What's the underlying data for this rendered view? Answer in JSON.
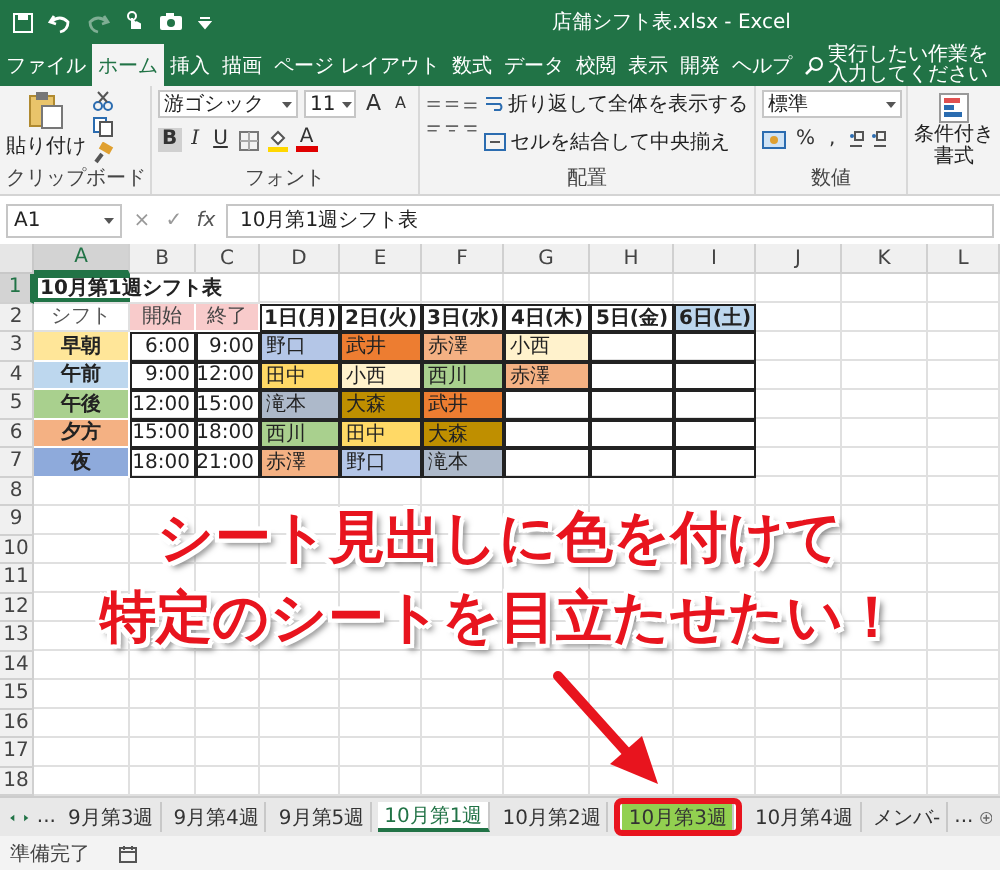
{
  "window": {
    "title": "店舗シフト表.xlsx - Excel"
  },
  "ribbon_tabs": [
    {
      "label": "ファイル",
      "selected": false
    },
    {
      "label": "ホーム",
      "selected": true
    },
    {
      "label": "挿入",
      "selected": false
    },
    {
      "label": "描画",
      "selected": false
    },
    {
      "label": "ページ レイアウト",
      "selected": false
    },
    {
      "label": "数式",
      "selected": false
    },
    {
      "label": "データ",
      "selected": false
    },
    {
      "label": "校閲",
      "selected": false
    },
    {
      "label": "表示",
      "selected": false
    },
    {
      "label": "開発",
      "selected": false
    },
    {
      "label": "ヘルプ",
      "selected": false
    }
  ],
  "search": {
    "placeholder": "実行したい作業を入力してください"
  },
  "ribbon": {
    "clipboard": {
      "paste": "貼り付け",
      "label": "クリップボード"
    },
    "font": {
      "name": "游ゴシック",
      "size": "11",
      "grow": "A",
      "shrink": "A",
      "bold": "B",
      "italic": "I",
      "underline": "U",
      "font_color": "A",
      "label": "フォント"
    },
    "alignment": {
      "wrap": "折り返して全体を表示する",
      "merge": "セルを結合して中央揃え",
      "label": "配置"
    },
    "number": {
      "format": "標準",
      "percent": "%",
      "comma": ",",
      "label": "数値"
    },
    "styles": {
      "conditional": "条件付き書式"
    }
  },
  "formula_bar": {
    "name_box": "A1",
    "cancel": "×",
    "enter": "✓",
    "function_label": "fx",
    "formula": "10月第1週シフト表"
  },
  "sheet": {
    "columns": [
      {
        "label": "A",
        "selected": true
      },
      {
        "label": "B",
        "selected": false
      },
      {
        "label": "C",
        "selected": false
      },
      {
        "label": "D",
        "selected": false
      },
      {
        "label": "E",
        "selected": false
      },
      {
        "label": "F",
        "selected": false
      },
      {
        "label": "G",
        "selected": false
      },
      {
        "label": "H",
        "selected": false
      },
      {
        "label": "I",
        "selected": false
      },
      {
        "label": "J",
        "selected": false
      },
      {
        "label": "K",
        "selected": false
      },
      {
        "label": "L",
        "selected": false
      }
    ],
    "rows": [
      {
        "number": "1",
        "selected": true,
        "cells": [
          {
            "kind": "title",
            "text": "10月第1週シフト表"
          }
        ]
      },
      {
        "number": "2",
        "selected": false,
        "cells": [
          {
            "kind": "label",
            "text": "シフト"
          },
          {
            "kind": "head",
            "text": "開始",
            "color": "#f8cbcb"
          },
          {
            "kind": "head",
            "text": "終了",
            "color": "#f8cbcb"
          },
          {
            "kind": "day",
            "text": "1日(月)"
          },
          {
            "kind": "day",
            "text": "2日(火)"
          },
          {
            "kind": "day",
            "text": "3日(水)"
          },
          {
            "kind": "day",
            "text": "4日(木)"
          },
          {
            "kind": "day",
            "text": "5日(金)"
          },
          {
            "kind": "day",
            "text": "6日(土)",
            "color": "#bdd7ee"
          }
        ]
      },
      {
        "number": "3",
        "selected": false,
        "cells": [
          {
            "kind": "shift",
            "text": "早朝",
            "color": "#ffe699"
          },
          {
            "kind": "time",
            "text": "6:00"
          },
          {
            "kind": "time",
            "text": "9:00"
          },
          {
            "kind": "name",
            "text": "野口",
            "color": "#b4c6e7"
          },
          {
            "kind": "name",
            "text": "武井",
            "color": "#ed7d31"
          },
          {
            "kind": "name",
            "text": "赤澤",
            "color": "#f4b183"
          },
          {
            "kind": "name",
            "text": "小西",
            "color": "#fff2cc"
          },
          {
            "kind": "blank"
          },
          {
            "kind": "blank"
          }
        ]
      },
      {
        "number": "4",
        "selected": false,
        "cells": [
          {
            "kind": "shift",
            "text": "午前",
            "color": "#bdd7ee"
          },
          {
            "kind": "time",
            "text": "9:00"
          },
          {
            "kind": "time",
            "text": "12:00"
          },
          {
            "kind": "name",
            "text": "田中",
            "color": "#ffd966"
          },
          {
            "kind": "name",
            "text": "小西",
            "color": "#fff2cc"
          },
          {
            "kind": "name",
            "text": "西川",
            "color": "#a9d08e"
          },
          {
            "kind": "name",
            "text": "赤澤",
            "color": "#f4b183"
          },
          {
            "kind": "blank"
          },
          {
            "kind": "blank"
          }
        ]
      },
      {
        "number": "5",
        "selected": false,
        "cells": [
          {
            "kind": "shift",
            "text": "午後",
            "color": "#a9d08e"
          },
          {
            "kind": "time",
            "text": "12:00"
          },
          {
            "kind": "time",
            "text": "15:00"
          },
          {
            "kind": "name",
            "text": "滝本",
            "color": "#adb9ca"
          },
          {
            "kind": "name",
            "text": "大森",
            "color": "#bf8f00"
          },
          {
            "kind": "name",
            "text": "武井",
            "color": "#ed7d31"
          },
          {
            "kind": "blank"
          },
          {
            "kind": "blank"
          },
          {
            "kind": "blank"
          }
        ]
      },
      {
        "number": "6",
        "selected": false,
        "cells": [
          {
            "kind": "shift",
            "text": "夕方",
            "color": "#f4b183"
          },
          {
            "kind": "time",
            "text": "15:00"
          },
          {
            "kind": "time",
            "text": "18:00"
          },
          {
            "kind": "name",
            "text": "西川",
            "color": "#a9d08e"
          },
          {
            "kind": "name",
            "text": "田中",
            "color": "#ffd966"
          },
          {
            "kind": "name",
            "text": "大森",
            "color": "#bf8f00"
          },
          {
            "kind": "blank"
          },
          {
            "kind": "blank"
          },
          {
            "kind": "blank"
          }
        ]
      },
      {
        "number": "7",
        "selected": false,
        "cells": [
          {
            "kind": "shift",
            "text": "夜",
            "color": "#8eaadb"
          },
          {
            "kind": "time",
            "text": "18:00"
          },
          {
            "kind": "time",
            "text": "21:00"
          },
          {
            "kind": "name",
            "text": "赤澤",
            "color": "#f4b183"
          },
          {
            "kind": "name",
            "text": "野口",
            "color": "#b4c6e7"
          },
          {
            "kind": "name",
            "text": "滝本",
            "color": "#adb9ca"
          },
          {
            "kind": "blank"
          },
          {
            "kind": "blank"
          },
          {
            "kind": "blank"
          }
        ]
      },
      {
        "number": "8",
        "selected": false
      },
      {
        "number": "9",
        "selected": false
      },
      {
        "number": "10",
        "selected": false
      },
      {
        "number": "11",
        "selected": false
      },
      {
        "number": "12",
        "selected": false
      },
      {
        "number": "13",
        "selected": false
      },
      {
        "number": "14",
        "selected": false
      },
      {
        "number": "15",
        "selected": false
      },
      {
        "number": "16",
        "selected": false
      },
      {
        "number": "17",
        "selected": false
      },
      {
        "number": "18",
        "selected": false
      }
    ]
  },
  "sheet_tabs": {
    "more_left": "...",
    "tabs": [
      {
        "label": "9月第3週",
        "selected": false,
        "highlighted": false
      },
      {
        "label": "9月第4週",
        "selected": false,
        "highlighted": false
      },
      {
        "label": "9月第5週",
        "selected": false,
        "highlighted": false
      },
      {
        "label": "10月第1週",
        "selected": true,
        "highlighted": false
      },
      {
        "label": "10月第2週",
        "selected": false,
        "highlighted": false
      },
      {
        "label": "10月第3週",
        "selected": false,
        "highlighted": true,
        "color": "#92d050"
      },
      {
        "label": "10月第4週",
        "selected": false,
        "highlighted": false
      },
      {
        "label": "メンバ-",
        "selected": false,
        "highlighted": false
      }
    ],
    "more_right": "..."
  },
  "status_bar": {
    "text": "準備完了"
  },
  "annotation": {
    "lines": [
      "シート見出しに色を付けて",
      "特定のシートを目立たせたい！"
    ]
  }
}
